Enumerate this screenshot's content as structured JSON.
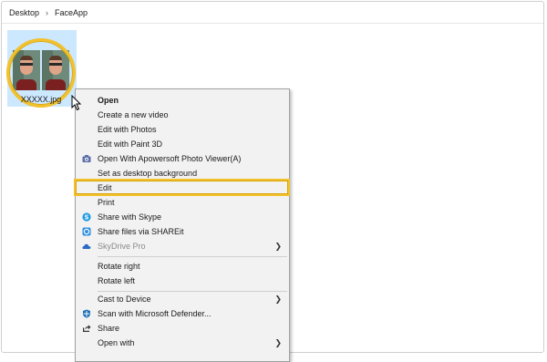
{
  "breadcrumb": {
    "items": [
      "Desktop",
      "FaceApp"
    ],
    "separator": "›"
  },
  "file": {
    "name": "XXXXX.jpg"
  },
  "colors": {
    "highlight": "#f2c12e",
    "selection": "#cce8ff"
  },
  "context_menu": {
    "open": "Open",
    "create_video": "Create a new video",
    "edit_photos": "Edit with Photos",
    "edit_paint3d": "Edit with Paint 3D",
    "open_apowersoft": "Open With Apowersoft Photo Viewer(A)",
    "set_background": "Set as desktop background",
    "edit": "Edit",
    "print": "Print",
    "share_skype": "Share with Skype",
    "share_shareit": "Share files via SHAREit",
    "skydrive": "SkyDrive Pro",
    "rotate_right": "Rotate right",
    "rotate_left": "Rotate left",
    "cast": "Cast to Device",
    "scan_defender": "Scan with Microsoft Defender...",
    "share": "Share",
    "open_with": "Open with"
  }
}
